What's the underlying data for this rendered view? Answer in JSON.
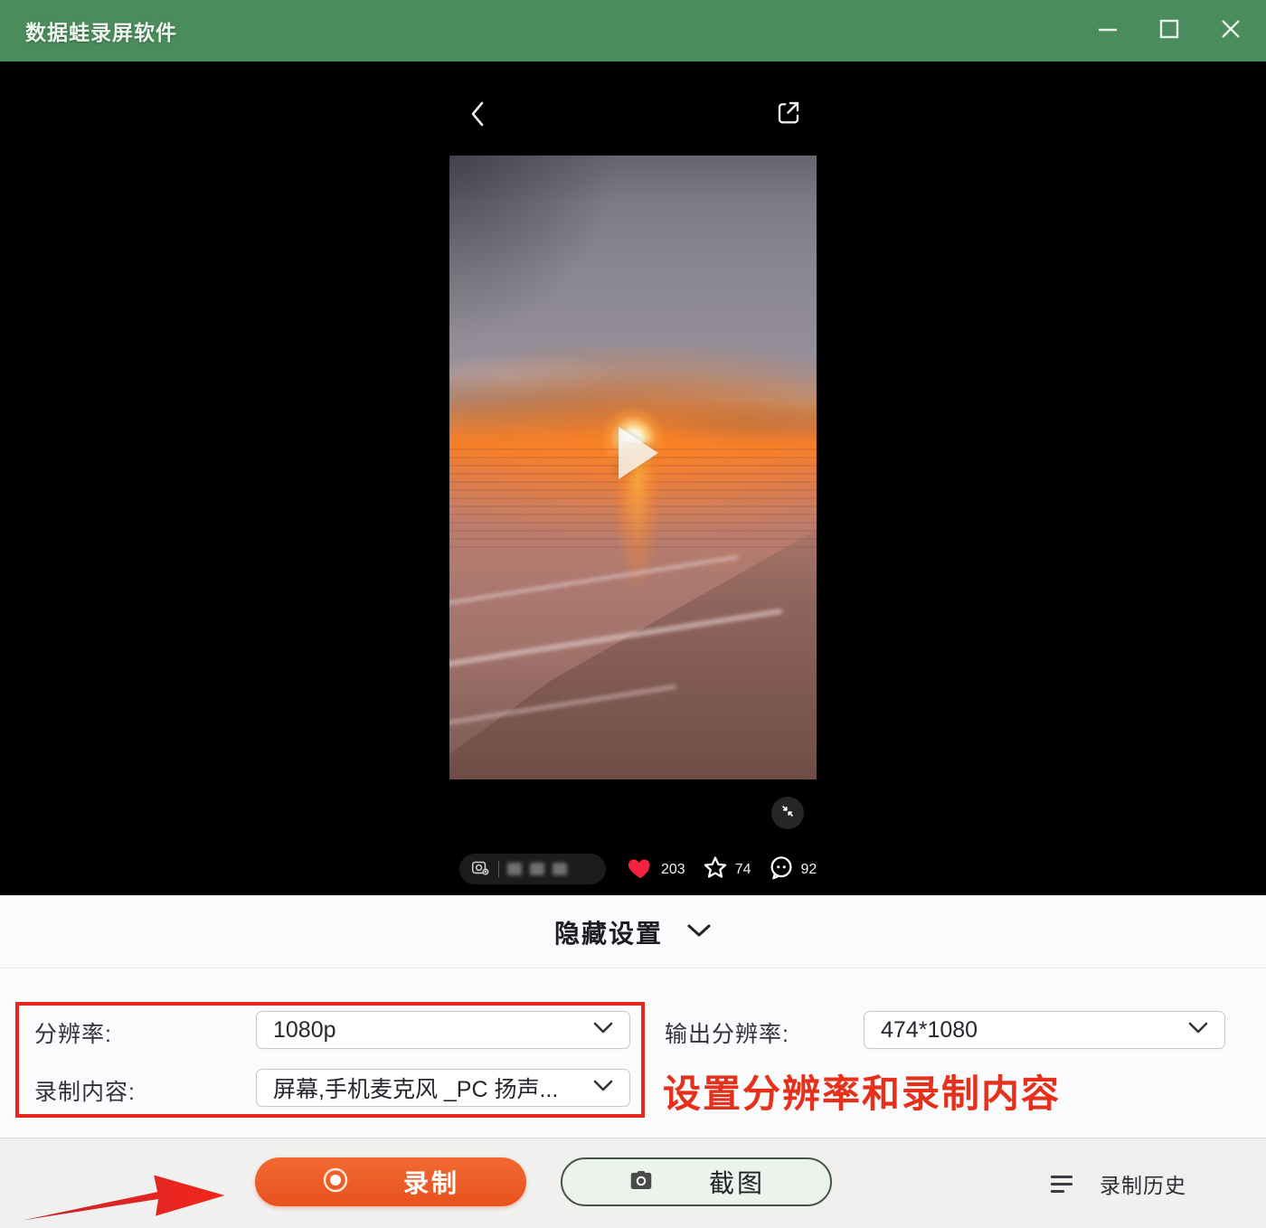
{
  "titlebar": {
    "title": "数据蛙录屏软件"
  },
  "player": {
    "like_count": "203",
    "favorite_count": "74",
    "comment_count": "92"
  },
  "settings": {
    "toggle_label": "隐藏设置",
    "resolution": {
      "label": "分辨率:",
      "value": "1080p"
    },
    "record_content": {
      "label": "录制内容:",
      "value": "屏幕,手机麦克风 _PC 扬声..."
    },
    "output_resolution": {
      "label": "输出分辨率:",
      "value": "474*1080"
    },
    "annotation_text": "设置分辨率和录制内容"
  },
  "toolbar": {
    "record_label": "录制",
    "screenshot_label": "截图",
    "history_label": "录制历史"
  },
  "icons": {
    "minimize": "minimize-icon",
    "maximize": "maximize-icon",
    "close": "close-icon",
    "back": "back-icon",
    "share": "external-link-icon",
    "play": "play-icon",
    "collapse": "collapse-icon",
    "like": "heart-icon",
    "favorite": "star-icon",
    "comment": "comment-bubble-icon",
    "dropdown": "chevron-down-icon",
    "record": "record-dot-icon",
    "screenshot": "camera-icon",
    "history": "list-icon"
  },
  "colors": {
    "titlebar_green": "#4a8c5c",
    "record_orange": "#e8521e",
    "annotation_red": "#e5301c",
    "heart_red": "#f5223d"
  }
}
